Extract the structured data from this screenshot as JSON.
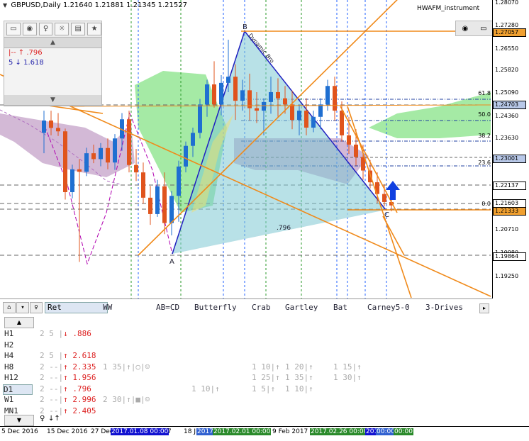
{
  "header": {
    "symbol": "GBPUSD,Daily",
    "ohlc": "1.21640 1.21881 1.21345 1.21527",
    "indicator": "HWAFM_instrument"
  },
  "panel": {
    "row1": "|--  ↑  .796",
    "row2": "5  ↓ 1.618"
  },
  "price_axis": {
    "ticks": [
      "1.28070",
      "1.27280",
      "1.26550",
      "1.25820",
      "1.25090",
      "1.24360",
      "1.23630",
      "1.22900",
      "1.22137",
      "1.21603",
      "1.20710",
      "1.19980",
      "1.19250"
    ],
    "labels": [
      {
        "text": "1.27057",
        "color": "#f0a030"
      },
      {
        "text": "1.24703",
        "color": "#b8c8e8"
      },
      {
        "text": "1.23001",
        "color": "#b8c8e8"
      },
      {
        "text": "1.22137",
        "color": "#ffffff"
      },
      {
        "text": "1.21603",
        "color": "#ffffff"
      },
      {
        "text": "1.21333",
        "color": "#f0a030"
      },
      {
        "text": "1.19864",
        "color": "#ffffff"
      }
    ]
  },
  "fib_levels": [
    "61.8",
    "50.0",
    "38.2",
    "23.6",
    "0.0"
  ],
  "pattern_points": {
    "a": "A",
    "b": "B",
    "c": "C",
    "ratio": ".796",
    "pattern_name": "Dynamic Bro"
  },
  "chart_data": {
    "type": "candlestick",
    "series": [
      {
        "values": [
          [
            1.2388,
            1.246,
            1.2322,
            1.2428
          ],
          [
            1.2428,
            1.246,
            1.238,
            1.2404
          ],
          [
            1.2404,
            1.2452,
            1.2378,
            1.2393
          ],
          [
            1.2393,
            1.2402,
            1.2172,
            1.2196
          ],
          [
            1.2196,
            1.2285,
            1.2176,
            1.227
          ],
          [
            1.227,
            1.2303,
            1.197,
            1.2262
          ],
          [
            1.2262,
            1.234,
            1.2248,
            1.2322
          ],
          [
            1.2322,
            1.235,
            1.229,
            1.2303
          ],
          [
            1.2303,
            1.2355,
            1.228,
            1.2339
          ],
          [
            1.2339,
            1.237,
            1.227,
            1.2292
          ],
          [
            1.2292,
            1.2384,
            1.2268,
            1.237
          ],
          [
            1.237,
            1.2452,
            1.233,
            1.2432
          ],
          [
            1.2432,
            1.246,
            1.226,
            1.2284
          ],
          [
            1.2284,
            1.2336,
            1.2232,
            1.226
          ],
          [
            1.226,
            1.2292,
            1.2158,
            1.2178
          ],
          [
            1.2178,
            1.2216,
            1.209,
            1.2125
          ],
          [
            1.2125,
            1.2236,
            1.2116,
            1.2215
          ],
          [
            1.2215,
            1.226,
            1.206,
            1.2096
          ],
          [
            1.2096,
            1.22,
            1.2056,
            1.2184
          ],
          [
            1.2184,
            1.2298,
            1.21,
            1.2279
          ],
          [
            1.2279,
            1.236,
            1.226,
            1.2346
          ],
          [
            1.2346,
            1.2405,
            1.231,
            1.2388
          ],
          [
            1.2388,
            1.2498,
            1.237,
            1.248
          ],
          [
            1.248,
            1.256,
            1.244,
            1.2545
          ],
          [
            1.2545,
            1.262,
            1.247,
            1.248
          ],
          [
            1.248,
            1.2575,
            1.2445,
            1.255
          ],
          [
            1.255,
            1.269,
            1.252,
            1.257
          ],
          [
            1.257,
            1.261,
            1.243,
            1.2492
          ],
          [
            1.2492,
            1.256,
            1.246,
            1.2526
          ],
          [
            1.2526,
            1.258,
            1.2428,
            1.2468
          ],
          [
            1.2468,
            1.252,
            1.242,
            1.246
          ],
          [
            1.246,
            1.25,
            1.238,
            1.2488
          ],
          [
            1.2488,
            1.257,
            1.245,
            1.252
          ],
          [
            1.252,
            1.2565,
            1.244,
            1.25
          ],
          [
            1.25,
            1.254,
            1.245,
            1.248
          ],
          [
            1.248,
            1.2525,
            1.24,
            1.243
          ],
          [
            1.243,
            1.248,
            1.238,
            1.246
          ],
          [
            1.246,
            1.25,
            1.238,
            1.2405
          ],
          [
            1.2405,
            1.246,
            1.239,
            1.244
          ],
          [
            1.244,
            1.25,
            1.24,
            1.248
          ],
          [
            1.248,
            1.256,
            1.246,
            1.254
          ],
          [
            1.254,
            1.257,
            1.2428,
            1.246
          ],
          [
            1.246,
            1.249,
            1.236,
            1.238
          ],
          [
            1.238,
            1.244,
            1.232,
            1.235
          ],
          [
            1.235,
            1.24,
            1.2282,
            1.231
          ],
          [
            1.231,
            1.235,
            1.2236,
            1.2266
          ],
          [
            1.2266,
            1.23,
            1.2208,
            1.2228
          ],
          [
            1.2228,
            1.226,
            1.216,
            1.219
          ],
          [
            1.219,
            1.2222,
            1.215,
            1.2164
          ],
          [
            1.2164,
            1.2188,
            1.2134,
            1.2153
          ]
        ]
      }
    ],
    "x_tick_labels": [
      "5 Dec 2016",
      "15 Dec 2016",
      "27 Dec",
      "2017.01.08 00:00",
      "7",
      "18 J",
      "2017",
      "2017.02.01 00:00",
      "9 Feb 2017",
      "2017.02.26 00:00",
      "2017.03",
      "00:00",
      "00:00"
    ]
  },
  "bottom": {
    "search_value": "Ret",
    "tabs": [
      "WW",
      "AB=CD",
      "Butterfly",
      "Crab",
      "Gartley",
      "Bat",
      "Carney5-0",
      "3-Drives"
    ],
    "rows": [
      {
        "tf": "H1",
        "c1": "2  5 |↓  .886",
        "cols": []
      },
      {
        "tf": "H2",
        "c1": "",
        "cols": []
      },
      {
        "tf": "H4",
        "c1": "2  5 |↑ 2.618",
        "cols": []
      },
      {
        "tf": "H8",
        "c1": "2 --|↑ 2.335",
        "cols": [
          "1 35|↑|○|☺",
          "1 10|↑",
          "1 20|↑",
          "1 15|↑"
        ]
      },
      {
        "tf": "H12",
        "c1": "2 --|↑ 1.956",
        "cols": [
          "1 25|↑",
          "1 35|↑",
          "1 30|↑"
        ]
      },
      {
        "tf": "D1",
        "c1": "2 --|↑  .796",
        "cols": [
          "1 10|↑",
          "1 5|↑",
          "1 10|↑"
        ]
      },
      {
        "tf": "W1",
        "c1": "2 --|↑ 2.996",
        "cols": [
          "2 30|↑|■|☺"
        ]
      },
      {
        "tf": "MN1",
        "c1": "2 --|↑ 2.405",
        "cols": []
      }
    ]
  }
}
